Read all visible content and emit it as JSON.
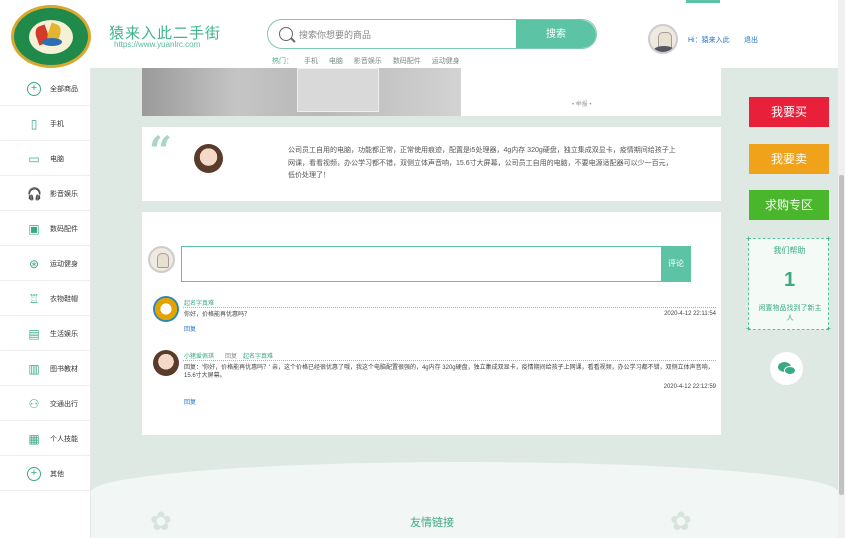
{
  "header": {
    "site_name": "猿来入此二手街",
    "site_url": "https://www.yuanlrc.com",
    "search_placeholder": "搜索你想要的商品",
    "search_button": "搜索",
    "hot_label": "热门：",
    "hot_tags": [
      "手机",
      "电脑",
      "影音娱乐",
      "数码配件",
      "运动健身"
    ],
    "user_greeting": "Hi：猿来入此",
    "logout": "退出"
  },
  "sidebar": {
    "items": [
      {
        "label": "全部商品",
        "icon": "plus-circle-icon",
        "glyph": "+"
      },
      {
        "label": "手机",
        "icon": "phone-icon",
        "glyph": "▯"
      },
      {
        "label": "电脑",
        "icon": "monitor-icon",
        "glyph": "▭"
      },
      {
        "label": "影音娱乐",
        "icon": "headphones-icon",
        "glyph": "🎧"
      },
      {
        "label": "数码配件",
        "icon": "camera-icon",
        "glyph": "▣"
      },
      {
        "label": "运动健身",
        "icon": "ball-icon",
        "glyph": "⊛"
      },
      {
        "label": "衣物鞋帽",
        "icon": "shirt-icon",
        "glyph": "♖"
      },
      {
        "label": "生活娱乐",
        "icon": "radio-icon",
        "glyph": "▤"
      },
      {
        "label": "图书教材",
        "icon": "book-icon",
        "glyph": "▥"
      },
      {
        "label": "交通出行",
        "icon": "bike-icon",
        "glyph": "⚇"
      },
      {
        "label": "个人技能",
        "icon": "tv-icon",
        "glyph": "▦"
      },
      {
        "label": "其他",
        "icon": "plus-circle-icon",
        "glyph": "+"
      }
    ]
  },
  "product": {
    "image_caption": "• 举报 •",
    "description": "公司员工自用的电脑，功能都正常，正常使用痕迹，配置是i5处理器，4g内存 320g硬盘，独立集成双显卡，疫情期间给孩子上网课，看看视频，办公学习都不错，双侧立体声音响，15.6寸大屏幕，公司员工自用的电脑，不要电源适配器可以少一百元，低价处理了！"
  },
  "comments": {
    "submit_button": "评论",
    "list": [
      {
        "name": "起名字真难",
        "text": "你好，价格能再优惠吗？",
        "time": "2020-4-12 22:11:54",
        "reply": "回复"
      },
      {
        "name": "小猪爱佩琪",
        "reply_word": "回复",
        "reply_to": "起名字真难",
        "text": "回复：'你好，价格能再优惠吗？' 亲，这个价格已经很优惠了哦，我这个电脑配置很强的，4g内存 320g硬盘，独立集成双显卡，疫情期间给孩子上网课，看看视频，办公学习都不错，双侧立体声音响，15.6寸大屏幕。",
        "time": "2020-4-12 22:12:59",
        "reply": "回复"
      }
    ]
  },
  "right_panel": {
    "buy": "我要买",
    "sell": "我要卖",
    "want": "求购专区",
    "help_title": "我们帮助",
    "help_count": "1",
    "help_sub": "闲置物品找到了新主人",
    "buy_color": "#e8203a",
    "sell_color": "#f0a21b",
    "want_color": "#49b62b"
  },
  "footer": {
    "title": "友情链接"
  }
}
